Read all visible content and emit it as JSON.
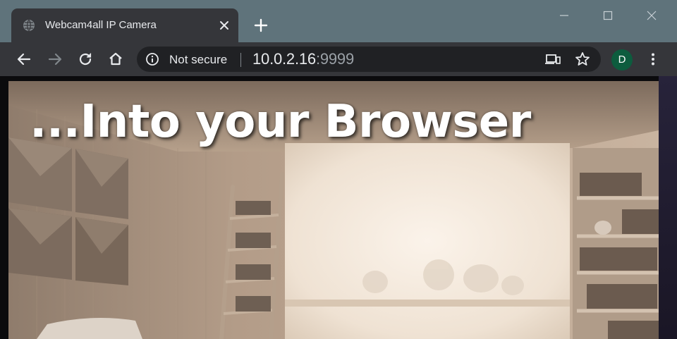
{
  "browser": {
    "tab": {
      "title": "Webcam4all IP Camera",
      "favicon": "globe-icon"
    },
    "address_bar": {
      "security_label": "Not secure",
      "url_host": "10.0.2.16",
      "url_port": ":9999"
    },
    "profile": {
      "initial": "D",
      "color": "#0d5c3e"
    },
    "colors": {
      "frame": "#5f737b",
      "toolbar": "#35363a",
      "omnibox": "#202124"
    }
  },
  "page": {
    "overlay_text": "...Into your Browser",
    "content": "webcam live view of a room"
  }
}
